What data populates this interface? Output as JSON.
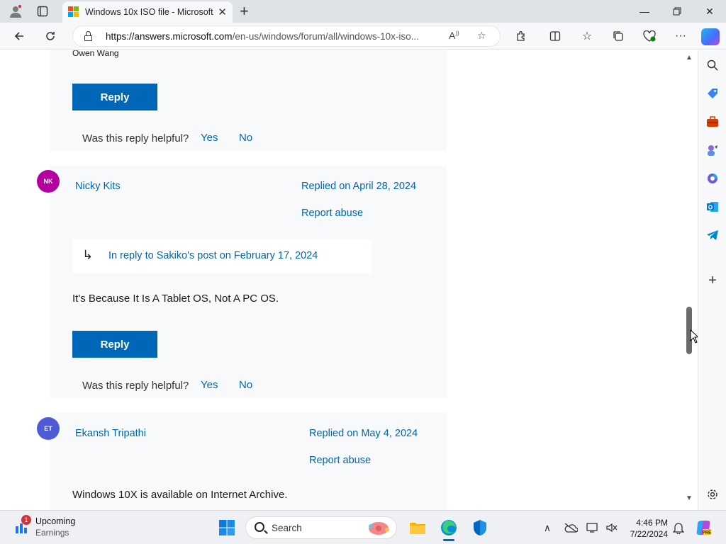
{
  "browser": {
    "tab_title": "Windows 10x ISO file - Microsoft",
    "url_host": "https://answers.microsoft.com",
    "url_path": "/en-us/windows/forum/all/windows-10x-iso...",
    "tab_icons": [
      "profile-icon",
      "tab-actions-icon"
    ],
    "toolbar_icons": [
      "back-icon",
      "refresh-icon",
      "read-aloud-icon",
      "favorite-star-icon",
      "extensions-icon",
      "split-screen-icon",
      "favorites-icon",
      "collections-icon",
      "browser-essentials-icon",
      "more-icon"
    ],
    "sidebar_icons": [
      "search-icon",
      "shopping-icon",
      "tools-icon",
      "games-icon",
      "microsoft365-icon",
      "outlook-icon",
      "telegram-icon",
      "add-icon",
      "settings-icon"
    ]
  },
  "thread": {
    "prev_signature": "Owen Wang",
    "reply_label": "Reply",
    "helpful_question": "Was this reply helpful?",
    "yes_label": "Yes",
    "no_label": "No",
    "report_abuse_label": "Report abuse",
    "posts": [
      {
        "initials": "NK",
        "author": "Nicky Kits",
        "date": "Replied on April 28, 2024",
        "quote": "In reply to Sakiko's post on February 17, 2024",
        "body": "It's Because It Is A Tablet OS, Not A PC OS.",
        "avatar_color": "#b4009e"
      },
      {
        "initials": "ET",
        "author": "Ekansh Tripathi",
        "date": "Replied on May 4, 2024",
        "body": "Windows 10X is available on Internet Archive.",
        "avatar_color": "#4f5bd5"
      }
    ]
  },
  "taskbar": {
    "weather_title": "Upcoming",
    "weather_subtitle": "Earnings",
    "weather_badge": "1",
    "search_label": "Search",
    "time": "4:46 PM",
    "date": "7/22/2024"
  },
  "colors": {
    "accent": "#0067b8",
    "link": "#0064b4",
    "card_bg": "#f8f9fa"
  }
}
